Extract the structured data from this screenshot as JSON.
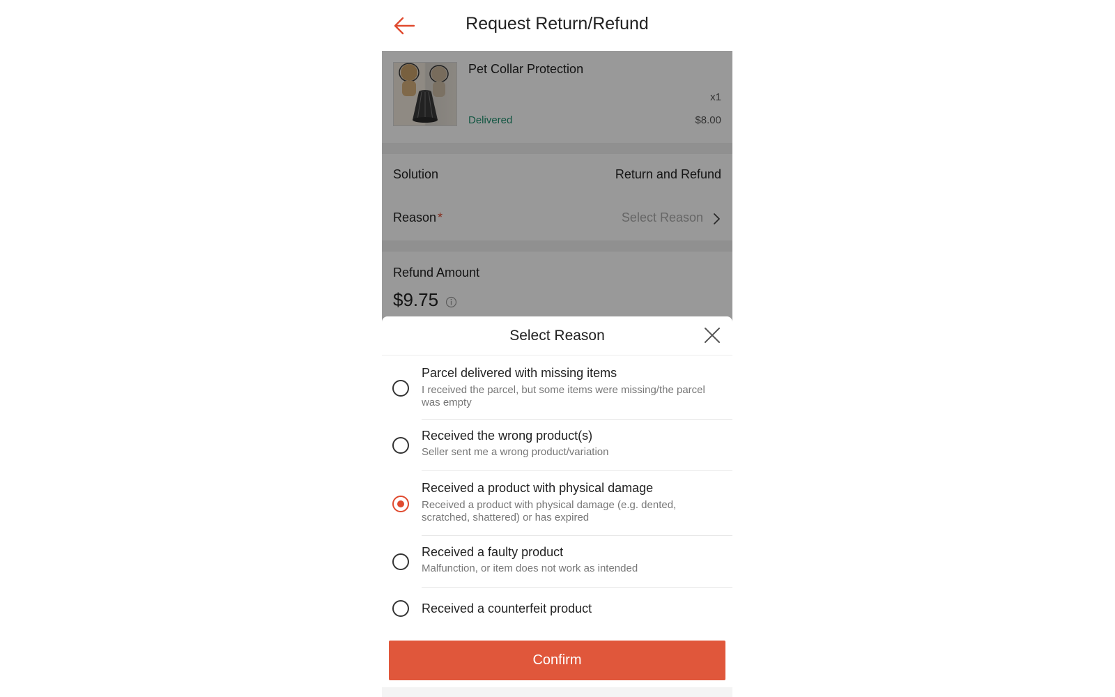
{
  "header": {
    "title": "Request Return/Refund",
    "back_icon": "arrow-left-icon",
    "accent_color": "#e04a2f"
  },
  "product": {
    "name": "Pet Collar Protection",
    "quantity": "x1",
    "status": "Delivered",
    "price": "$8.00"
  },
  "form": {
    "solution_label": "Solution",
    "solution_value": "Return and Refund",
    "reason_label": "Reason",
    "required_mark": "*",
    "reason_placeholder": "Select Reason",
    "refund_label": "Refund Amount",
    "refund_amount": "$9.75"
  },
  "sheet": {
    "title": "Select Reason",
    "options": [
      {
        "title": "Parcel delivered with missing items",
        "desc": "I received the parcel, but some items were missing/the parcel was empty",
        "selected": false
      },
      {
        "title": "Received the wrong product(s)",
        "desc": "Seller sent me a wrong product/variation",
        "selected": false
      },
      {
        "title": "Received a product with physical damage",
        "desc": "Received a product with physical damage (e.g. dented, scratched, shattered) or has expired",
        "selected": true
      },
      {
        "title": "Received a faulty product",
        "desc": "Malfunction, or item does not work as intended",
        "selected": false
      },
      {
        "title": "Received a counterfeit product",
        "desc": "",
        "selected": false
      }
    ],
    "confirm_label": "Confirm"
  }
}
